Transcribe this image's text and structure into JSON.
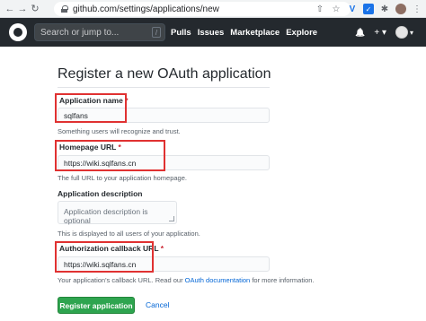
{
  "browser": {
    "back": "←",
    "forward": "→",
    "reload": "↻",
    "url": "github.com/settings/applications/new",
    "ext_share": "⇧",
    "ext_star": "☆",
    "ext_v": "V",
    "ext_blue": "✓",
    "ext_puzzle": "✱",
    "menu": "⋮"
  },
  "header": {
    "search_placeholder": "Search or jump to...",
    "search_shortcut": "/",
    "nav": [
      "Pulls",
      "Issues",
      "Marketplace",
      "Explore"
    ],
    "bell": "🔔",
    "plus": "+ ▾",
    "avatar_caret": "▾"
  },
  "form": {
    "title": "Register a new OAuth application",
    "app_name": {
      "label": "Application name",
      "required": "*",
      "value": "sqlfans",
      "note": "Something users will recognize and trust."
    },
    "homepage": {
      "label": "Homepage URL",
      "required": "*",
      "value": "https://wiki.sqlfans.cn",
      "note": "The full URL to your application homepage."
    },
    "description": {
      "label": "Application description",
      "placeholder": "Application description is optional",
      "note": "This is displayed to all users of your application."
    },
    "callback": {
      "label": "Authorization callback URL",
      "required": "*",
      "value": "https://wiki.sqlfans.cn",
      "note_before": "Your application's callback URL. Read our",
      "note_link": "OAuth documentation",
      "note_after": "for more information."
    },
    "submit_label": "Register application",
    "cancel_label": "Cancel"
  },
  "colors": {
    "header_bg": "#24292e",
    "primary_button": "#2ea44f",
    "link": "#0366d6",
    "highlight_box": "#e03131"
  }
}
